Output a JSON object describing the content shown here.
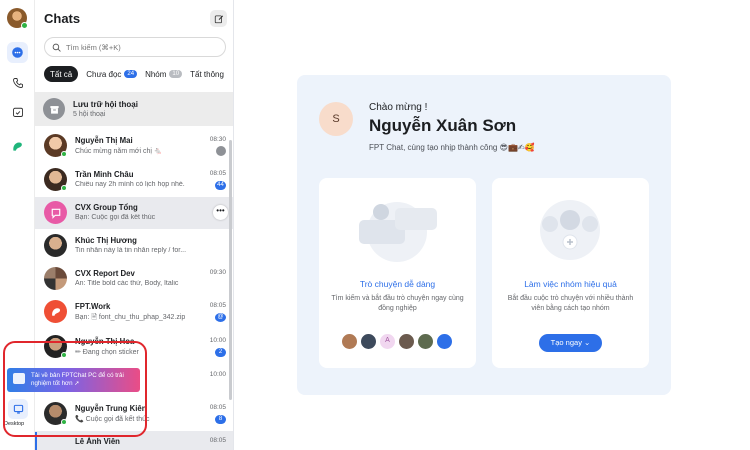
{
  "panel": {
    "title": "Chats",
    "search_placeholder": "Tìm kiếm (⌘+K)",
    "tabs": [
      {
        "label": "Tất cả"
      },
      {
        "label": "Chưa đọc",
        "count": "24"
      },
      {
        "label": "Nhóm",
        "count": "10"
      },
      {
        "label": "Tất thông"
      }
    ],
    "archive": {
      "title": "Lưu trữ hội thoại",
      "subtitle": "5 hội thoại"
    }
  },
  "chats": [
    {
      "name": "Nguyễn Thị Mai",
      "preview": "Chúc mừng năm mới chị 🐁",
      "time": "08:30",
      "badge": ""
    },
    {
      "name": "Trần Minh Châu",
      "preview": "Chiều nay 2h mình có lịch họp nhé.",
      "time": "08:05",
      "badge": "44"
    },
    {
      "name": "CVX Group Tổng",
      "preview": "Bạn: Cuộc gọi đã kết thúc",
      "time": "",
      "badge": ""
    },
    {
      "name": "Khúc Thị Hương",
      "preview": "Tin nhắn này là tin nhắn reply / for...",
      "time": "",
      "badge": ""
    },
    {
      "name": "CVX Report Dev",
      "preview": "An: Title bold các thứ, Body, Italic",
      "time": "09:30",
      "badge": ""
    },
    {
      "name": "FPT.Work",
      "preview": "Bạn: 🖹 font_chu_thu_phap_342.zip",
      "time": "08:05",
      "badge": ""
    },
    {
      "name": "Nguyễn Thị Hoa",
      "preview": "✏ Đang chọn sticker",
      "time": "10:00",
      "badge": "2"
    },
    {
      "name": "",
      "preview": "",
      "time": "10:00",
      "badge": ""
    },
    {
      "name": "Nguyễn Trung Kiên",
      "preview": "📞 Cuộc gọi đã kết thúc",
      "time": "08:05",
      "badge": "8"
    },
    {
      "name": "Lê Ánh Viên",
      "preview": "",
      "time": "08:05",
      "badge": ""
    }
  ],
  "promo": {
    "text": "Tải về bản FPTChat PC để có trải nghiệm tốt hơn ➚"
  },
  "desktop": {
    "label": "Desktop"
  },
  "welcome": {
    "avatar_letter": "S",
    "greeting": "Chào mừng !",
    "name": "Nguyễn Xuân Sơn",
    "subtitle": "FPT Chat, cùng tạo nhịp thành công 😎💼✍🥰",
    "card1": {
      "title": "Trò chuyện dễ dàng",
      "desc": "Tìm kiếm và bắt đầu trò chuyện ngay cùng đồng nghiệp"
    },
    "card2": {
      "title": "Làm việc nhóm hiệu quả",
      "desc": "Bắt đầu cuộc trò chuyện với nhiều thành viên bằng cách tạo nhóm",
      "button": "Tạo ngay ⌄"
    }
  },
  "colors": {
    "accent": "#2d6fe8",
    "online": "#2fb344",
    "highlight": "#e0262c"
  }
}
